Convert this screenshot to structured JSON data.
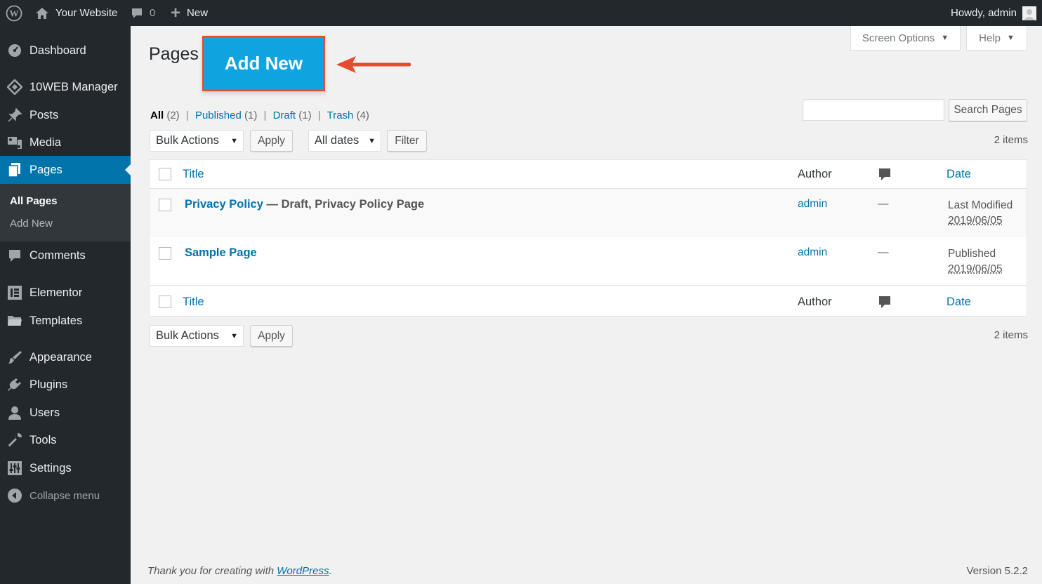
{
  "adminbar": {
    "site_name": "Your Website",
    "comments_count": "0",
    "new_label": "New",
    "greeting": "Howdy, admin"
  },
  "sidebar": {
    "items": [
      {
        "label": "Dashboard",
        "icon": "dashboard-icon"
      },
      {
        "label": "10WEB Manager",
        "icon": "tenweb-icon"
      },
      {
        "label": "Posts",
        "icon": "pin-icon"
      },
      {
        "label": "Media",
        "icon": "media-icon"
      },
      {
        "label": "Pages",
        "icon": "pages-icon"
      },
      {
        "label": "Comments",
        "icon": "comment-icon"
      },
      {
        "label": "Elementor",
        "icon": "elementor-icon"
      },
      {
        "label": "Templates",
        "icon": "folder-icon"
      },
      {
        "label": "Appearance",
        "icon": "brush-icon"
      },
      {
        "label": "Plugins",
        "icon": "plug-icon"
      },
      {
        "label": "Users",
        "icon": "user-icon"
      },
      {
        "label": "Tools",
        "icon": "wrench-icon"
      },
      {
        "label": "Settings",
        "icon": "settings-icon"
      }
    ],
    "submenu": [
      "All Pages",
      "Add New"
    ],
    "collapse_label": "Collapse menu"
  },
  "header": {
    "title": "Pages",
    "add_new": "Add New",
    "screen_options": "Screen Options",
    "help": "Help"
  },
  "filters": {
    "all": "All",
    "all_count": "(2)",
    "published": "Published",
    "published_count": "(1)",
    "draft": "Draft",
    "draft_count": "(1)",
    "trash": "Trash",
    "trash_count": "(4)",
    "separator": "|"
  },
  "search": {
    "value": "",
    "button": "Search Pages"
  },
  "toolbar": {
    "bulk_actions": "Bulk Actions",
    "apply": "Apply",
    "all_dates": "All dates",
    "filter": "Filter",
    "items_count": "2 items"
  },
  "table": {
    "columns": {
      "title": "Title",
      "author": "Author",
      "date": "Date"
    },
    "rows": [
      {
        "title": "Privacy Policy",
        "state": " — Draft, Privacy Policy Page",
        "author": "admin",
        "comments": "—",
        "status": "Last Modified",
        "date": "2019/06/05"
      },
      {
        "title": "Sample Page",
        "state": "",
        "author": "admin",
        "comments": "—",
        "status": "Published",
        "date": "2019/06/05"
      }
    ]
  },
  "footer": {
    "thanks_prefix": "Thank you for creating with ",
    "wordpress_link": "WordPress",
    "thanks_suffix": ".",
    "version": "Version 5.2.2"
  },
  "colors": {
    "adminbar": "#23282d",
    "accent": "#0073aa",
    "add_new_button": "#0fa3e0",
    "annotation": "#e44b2f"
  }
}
